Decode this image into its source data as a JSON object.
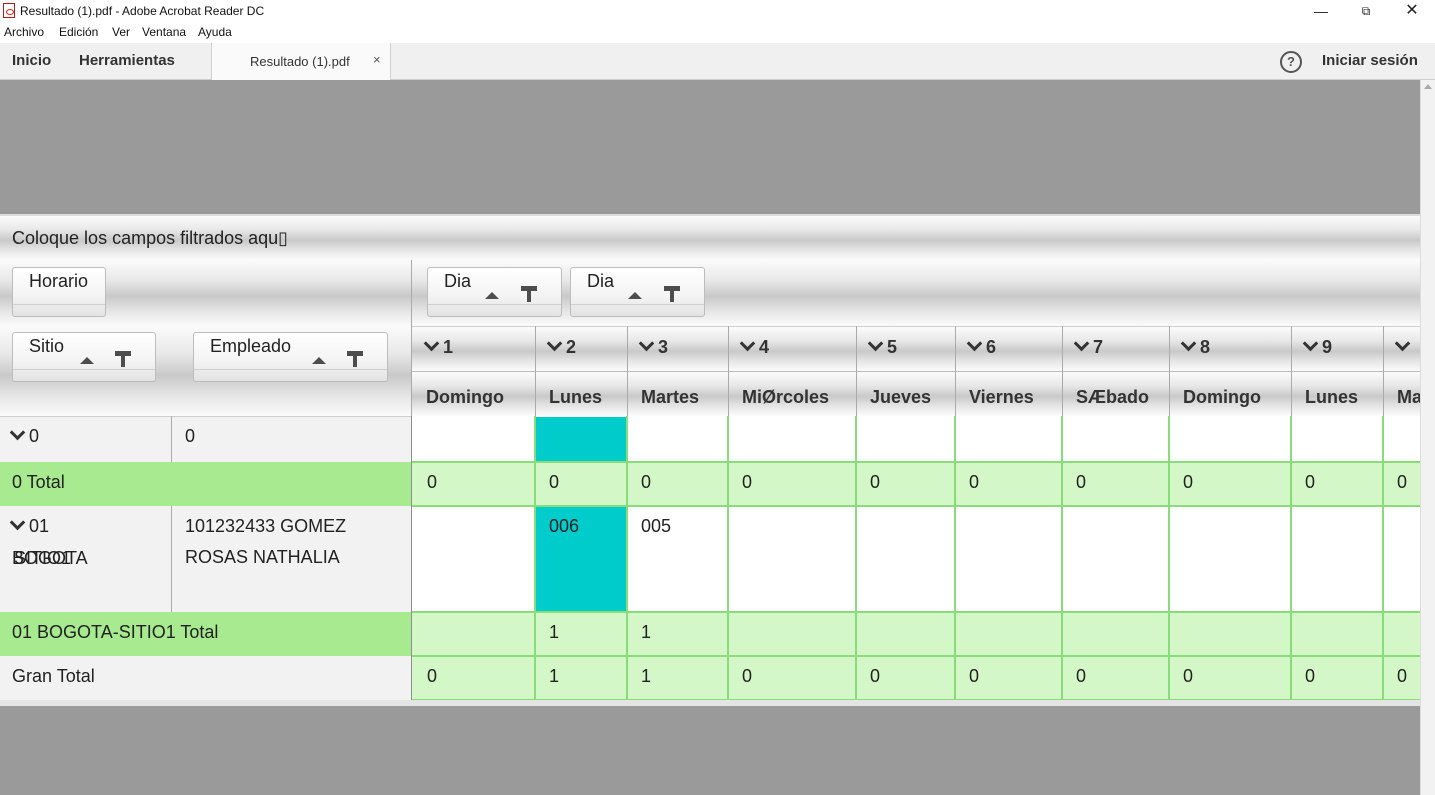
{
  "window": {
    "title": "Resultado (1).pdf - Adobe Acrobat Reader DC",
    "minimize": "—",
    "restore": "⧉",
    "close": "✕"
  },
  "menu": [
    "Archivo",
    "Edición",
    "Ver",
    "Ventana",
    "Ayuda"
  ],
  "toolbar": {
    "home": "Inicio",
    "tools": "Herramientas",
    "tab_label": "Resultado (1).pdf",
    "tab_close": "×",
    "help_icon": "?",
    "signin": "Iniciar sesión"
  },
  "pivot": {
    "filter_prompt": "Coloque los campos filtrados aqu▯",
    "fields": {
      "horario": "Horario",
      "dia_1": "Dia",
      "dia_2": "Dia",
      "sitio": "Sitio",
      "empleado": "Empleado"
    },
    "days": [
      {
        "num": "1",
        "name": "Domingo"
      },
      {
        "num": "2",
        "name": "Lunes"
      },
      {
        "num": "3",
        "name": "Martes"
      },
      {
        "num": "4",
        "name": "MiØrcoles"
      },
      {
        "num": "5",
        "name": "Jueves"
      },
      {
        "num": "6",
        "name": "Viernes"
      },
      {
        "num": "7",
        "name": "SÆbado"
      },
      {
        "num": "8",
        "name": "Domingo"
      },
      {
        "num": "9",
        "name": "Lunes"
      },
      {
        "num": "",
        "name": "Ma"
      }
    ],
    "rows": {
      "row0": {
        "sitio": "0",
        "empleado": "0",
        "values": [
          "",
          "",
          "",
          "",
          "",
          "",
          "",
          "",
          "",
          ""
        ]
      },
      "total0": {
        "label": "0 Total",
        "values": [
          "0",
          "0",
          "0",
          "0",
          "0",
          "0",
          "0",
          "0",
          "0",
          "0"
        ]
      },
      "row01": {
        "sitio_line1": "01",
        "sitio_line2a": "BOGOTA",
        "sitio_line2b": "SITIO1",
        "empleado_line1": "101232433 GOMEZ",
        "empleado_line2": "ROSAS NATHALIA",
        "values": [
          "",
          "006",
          "005",
          "",
          "",
          "",
          "",
          "",
          "",
          ""
        ]
      },
      "total01": {
        "label": "01 BOGOTA-SITIO1 Total",
        "values": [
          "",
          "1",
          "1",
          "",
          "",
          "",
          "",
          "",
          "",
          ""
        ]
      },
      "grand": {
        "label": "Gran Total",
        "values": [
          "0",
          "1",
          "1",
          "0",
          "0",
          "0",
          "0",
          "0",
          "0",
          "0"
        ]
      }
    },
    "colors": {
      "highlight": "#00cccc",
      "subtotal_green": "#a8ea90",
      "value_green": "#d4f7c8",
      "grid_green": "#88dd7a"
    }
  }
}
